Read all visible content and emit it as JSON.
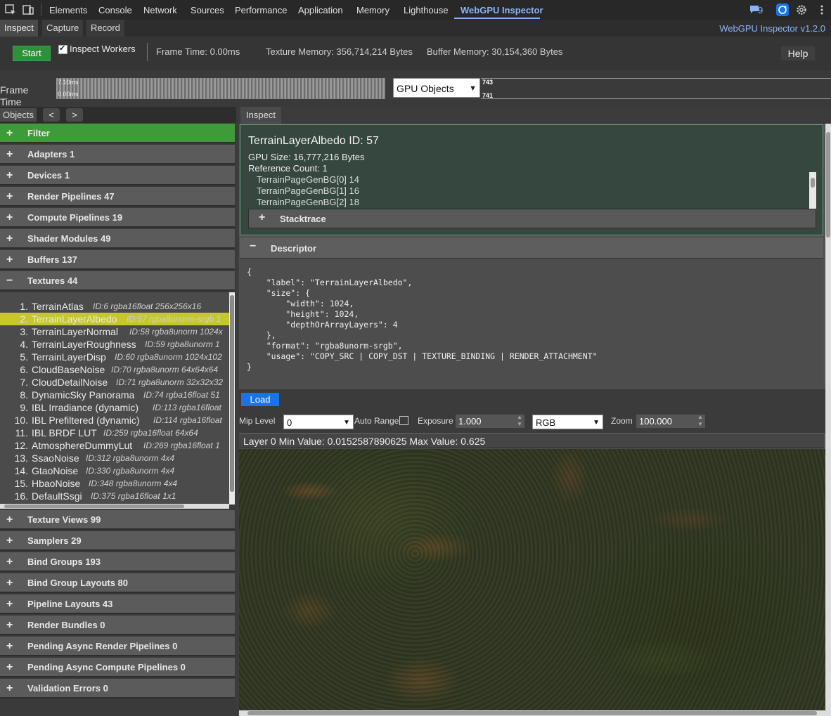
{
  "devtools": {
    "tabs": [
      "Elements",
      "Console",
      "Network",
      "Sources",
      "Performance",
      "Application",
      "Memory",
      "Lighthouse",
      "WebGPU Inspector"
    ],
    "active_tab": "WebGPU Inspector",
    "issues_count": "9"
  },
  "inspector": {
    "tabs": [
      "Inspect",
      "Capture",
      "Record"
    ],
    "version": "WebGPU Inspector v1.2.0"
  },
  "toolbar": {
    "start_label": "Start",
    "inspect_workers_label": "Inspect Workers",
    "frame_time": "Frame Time: 0.00ms",
    "texture_memory": "Texture Memory: 356,714,214 Bytes",
    "buffer_memory": "Buffer Memory: 30,154,360 Bytes",
    "help_label": "Help"
  },
  "frame_row": {
    "label": "Frame Time",
    "graph_max": "7.10ms",
    "graph_min": "0.00ms",
    "select_value": "GPU Objects",
    "count_top": "743",
    "count_bottom": "741"
  },
  "left": {
    "tab_label": "Objects",
    "prev_label": "<",
    "next_label": ">",
    "categories": [
      {
        "pm": "+",
        "label": "Filter"
      },
      {
        "pm": "+",
        "label": "Adapters 1"
      },
      {
        "pm": "+",
        "label": "Devices 1"
      },
      {
        "pm": "+",
        "label": "Render Pipelines 47"
      },
      {
        "pm": "+",
        "label": "Compute Pipelines 19"
      },
      {
        "pm": "+",
        "label": "Shader Modules 49"
      },
      {
        "pm": "+",
        "label": "Buffers 137"
      },
      {
        "pm": "−",
        "label": "Textures 44"
      },
      {
        "pm": "+",
        "label": "Texture Views 99"
      },
      {
        "pm": "+",
        "label": "Samplers 29"
      },
      {
        "pm": "+",
        "label": "Bind Groups 193"
      },
      {
        "pm": "+",
        "label": "Bind Group Layouts 80"
      },
      {
        "pm": "+",
        "label": "Pipeline Layouts 43"
      },
      {
        "pm": "+",
        "label": "Render Bundles 0"
      },
      {
        "pm": "+",
        "label": "Pending Async Render Pipelines 0"
      },
      {
        "pm": "+",
        "label": "Pending Async Compute Pipelines 0"
      },
      {
        "pm": "+",
        "label": "Validation Errors 0"
      }
    ],
    "textures": [
      {
        "num": "1.",
        "name": "TerrainAtlas",
        "meta": "ID:6   rgba16float 256x256x16"
      },
      {
        "num": "2.",
        "name": "TerrainLayerAlbedo",
        "meta": "ID:57   rgba8unorm-srgb 1"
      },
      {
        "num": "3.",
        "name": "TerrainLayerNormal",
        "meta": "ID:58   rgba8unorm 1024x"
      },
      {
        "num": "4.",
        "name": "TerrainLayerRoughness",
        "meta": "ID:59   rgba8unorm 1"
      },
      {
        "num": "5.",
        "name": "TerrainLayerDisp",
        "meta": "ID:60   rgba8unorm 1024x102"
      },
      {
        "num": "6.",
        "name": "CloudBaseNoise",
        "meta": "ID:70   rgba8unorm 64x64x64"
      },
      {
        "num": "7.",
        "name": "CloudDetailNoise",
        "meta": "ID:71   rgba8unorm 32x32x32"
      },
      {
        "num": "8.",
        "name": "DynamicSky Panorama",
        "meta": "ID:74   rgba16float 51"
      },
      {
        "num": "9.",
        "name": "IBL Irradiance (dynamic)",
        "meta": "ID:113   rgba16float"
      },
      {
        "num": "10.",
        "name": "IBL Prefiltered (dynamic)",
        "meta": "ID:114   rgba16float"
      },
      {
        "num": "11.",
        "name": "IBL BRDF LUT",
        "meta": "ID:259   rgba16float 64x64"
      },
      {
        "num": "12.",
        "name": "AtmosphereDummyLut",
        "meta": "ID:269   rgba16float 1"
      },
      {
        "num": "13.",
        "name": "SsaoNoise",
        "meta": "ID:312   rgba8unorm 4x4"
      },
      {
        "num": "14.",
        "name": "GtaoNoise",
        "meta": "ID:330   rgba8unorm 4x4"
      },
      {
        "num": "15.",
        "name": "HbaoNoise",
        "meta": "ID:348   rgba8unorm 4x4"
      },
      {
        "num": "16.",
        "name": "DefaultSsgi",
        "meta": "ID:375   rgba16float 1x1"
      }
    ],
    "selected_index": 1
  },
  "right": {
    "tab_label": "Inspect",
    "title": "TerrainLayerAlbedo ID: 57",
    "gpu_size": "GPU Size: 16,777,216 Bytes",
    "ref_count": "Reference Count: 1",
    "refs": [
      "TerrainPageGenBG[0] 14",
      "TerrainPageGenBG[1] 16",
      "TerrainPageGenBG[2] 18"
    ],
    "stacktrace_label": "Stacktrace",
    "descriptor_label": "Descriptor",
    "descriptor_lines": [
      "{",
      "    \"label\": \"TerrainLayerAlbedo\",",
      "    \"size\": {",
      "        \"width\": 1024,",
      "        \"height\": 1024,",
      "        \"depthOrArrayLayers\": 4",
      "    },",
      "    \"format\": \"rgba8unorm-srgb\",",
      "    \"usage\": \"COPY_SRC | COPY_DST | TEXTURE_BINDING | RENDER_ATTACHMENT\"",
      "}"
    ],
    "load_label": "Load",
    "mip_label": "Mip Level",
    "mip_value": "0",
    "auto_range_label": "Auto Range",
    "exposure_label": "Exposure",
    "exposure_value": "1.000",
    "channel_value": "RGB",
    "zoom_label": "Zoom",
    "zoom_value": "100.000",
    "minmax": "Layer 0 Min Value: 0.0152587890625 Max Value: 0.625"
  }
}
